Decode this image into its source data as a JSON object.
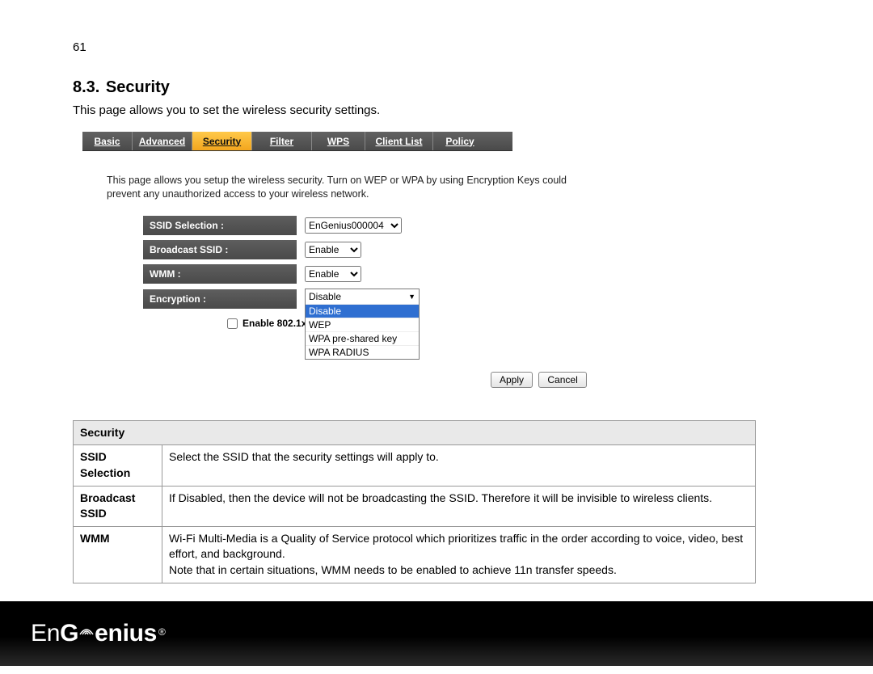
{
  "page_number": "61",
  "heading_number": "8.3.",
  "heading_text": "Security",
  "intro": "This page allows you to set the wireless security settings.",
  "screenshot": {
    "tabs": [
      "Basic",
      "Advanced",
      "Security",
      "Filter",
      "WPS",
      "Client List",
      "Policy"
    ],
    "sub_intro": "This page allows you setup the wireless security. Turn on WEP or WPA by using Encryption Keys could prevent any unauthorized access to your wireless network.",
    "fields": {
      "ssid_label": "SSID Selection :",
      "ssid_value": "EnGenius000004",
      "broadcast_label": "Broadcast SSID :",
      "broadcast_value": "Enable",
      "wmm_label": "WMM :",
      "wmm_value": "Enable",
      "encryption_label": "Encryption :",
      "encryption_value": "Disable",
      "encryption_options": [
        "Disable",
        "WEP",
        "WPA pre-shared key",
        "WPA RADIUS"
      ],
      "auth_label": "Enable 802.1x Authentica"
    },
    "buttons": {
      "apply": "Apply",
      "cancel": "Cancel"
    }
  },
  "table": {
    "header": "Security",
    "rows": [
      {
        "key": "SSID Selection",
        "val": "Select the SSID that the security settings will apply to."
      },
      {
        "key": "Broadcast SSID",
        "val": "If Disabled, then the device will not be broadcasting the SSID. Therefore it will be invisible to wireless clients."
      },
      {
        "key": "WMM",
        "val": "Wi-Fi Multi-Media is a Quality of Service protocol which prioritizes traffic in the order according to voice, video, best effort, and background.\nNote that in certain situations, WMM needs to be enabled to achieve 11n transfer speeds."
      }
    ]
  },
  "footer": {
    "brand_en": "En",
    "brand_rest": "enius",
    "brand_g": "G"
  }
}
